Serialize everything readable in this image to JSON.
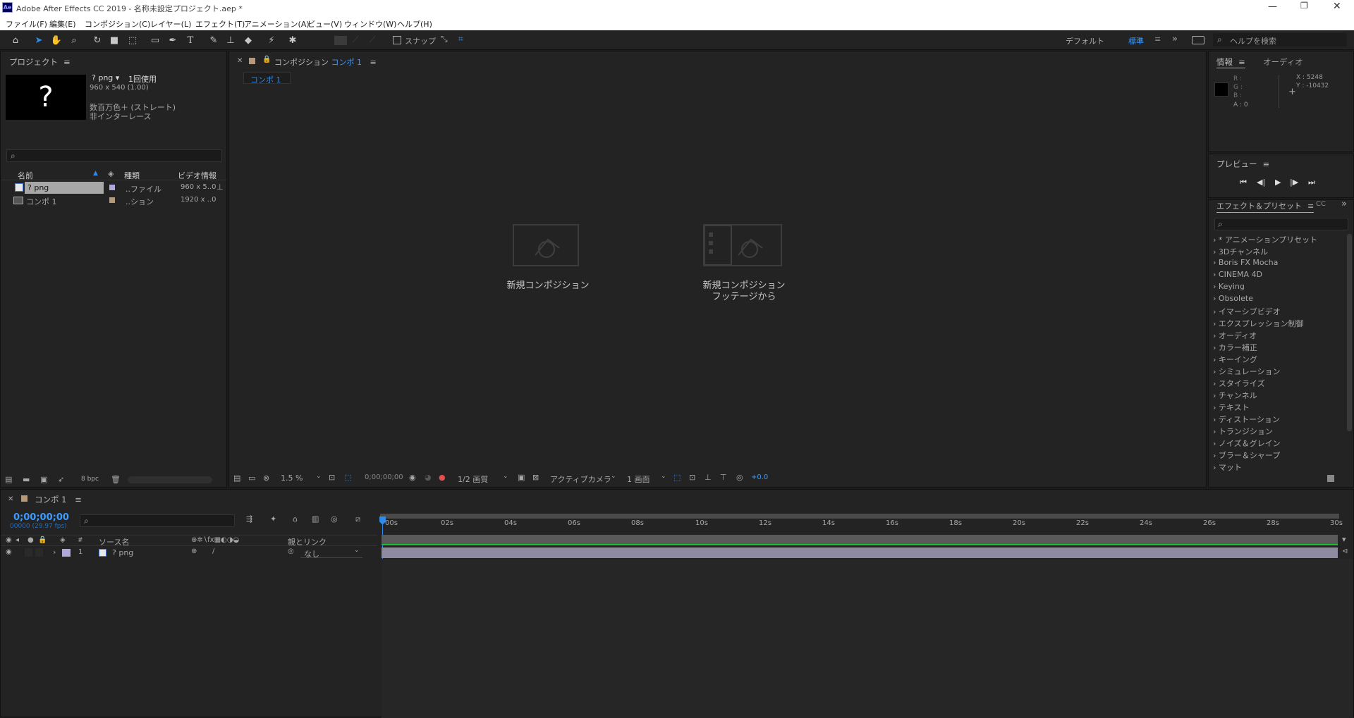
{
  "app": {
    "title": "Adobe After Effects CC 2019 - 名称未設定プロジェクト.aep *",
    "icon_text": "Ae",
    "accent": "#2d8ceb"
  },
  "menu": [
    "ファイル(F)",
    "編集(E)",
    "コンポジション(C)",
    "レイヤー(L)",
    "エフェクト(T)",
    "アニメーション(A)",
    "ビュー(V)",
    "ウィンドウ(W)",
    "ヘルプ(H)"
  ],
  "toolbar": {
    "snap_label": "スナップ",
    "workspaces": [
      "デフォルト",
      "標準"
    ],
    "search_placeholder": "ヘルプを検索"
  },
  "project": {
    "title": "プロジェクト",
    "thumb_glyph": "?",
    "item_name": "? png ▾",
    "usage": "1回使用",
    "dims": "960 x 540 (1.00)",
    "color": "数百万色＋ (ストレート)",
    "interlace": "非インターレース",
    "columns": [
      "名前",
      "種類",
      "ビデオ情報"
    ],
    "rows": [
      {
        "name": "? png",
        "type": "..ファイル",
        "video": "960 x 5..0",
        "label_color": "#b0a8d8"
      },
      {
        "name": "コンポ 1",
        "type": "..ション",
        "video": "1920 x ..0",
        "label_color": "#b49a7a"
      }
    ],
    "bpc": "8 bpc"
  },
  "composition": {
    "panel_label": "コンポジション",
    "comp_name": "コンポ 1",
    "tab": "コンポ 1",
    "new_comp": "新規コンポジション",
    "new_comp_footage_1": "新規コンポジション",
    "new_comp_footage_2": "フッテージから",
    "zoom": "1.5 %",
    "timecode": "0;00;00;00",
    "resolution": "1/2 画質",
    "camera": "アクティブカメラ",
    "views": "1 画面",
    "exposure": "+0.0"
  },
  "info": {
    "title": "情報",
    "audio_tab": "オーディオ",
    "r": "R :",
    "g": "G :",
    "b": "B :",
    "a": "A : 0",
    "x": "X : 5248",
    "y": "Y : -10432"
  },
  "preview": {
    "title": "プレビュー"
  },
  "effects": {
    "title": "エフェクト＆プリセット",
    "cc_tab": "CC",
    "items": [
      "* アニメーションプリセット",
      "3Dチャンネル",
      "Boris FX Mocha",
      "CINEMA 4D",
      "Keying",
      "Obsolete",
      "イマーシブビデオ",
      "エクスプレッション制御",
      "オーディオ",
      "カラー補正",
      "キーイング",
      "シミュレーション",
      "スタイライズ",
      "チャンネル",
      "テキスト",
      "ディストーション",
      "トランジション",
      "ノイズ＆グレイン",
      "ブラー＆シャープ",
      "マット"
    ]
  },
  "timeline": {
    "tab": "コンポ 1",
    "timecode": "0;00;00;00",
    "fps": "00000 (29.97 fps)",
    "col_num": "#",
    "col_source": "ソース名",
    "col_parent": "親とリンク",
    "layer": {
      "num": "1",
      "name": "? png",
      "parent": "なし",
      "label_color": "#b0a8d8"
    },
    "ticks": [
      "00s",
      "02s",
      "04s",
      "06s",
      "08s",
      "10s",
      "12s",
      "14s",
      "16s",
      "18s",
      "20s",
      "22s",
      "24s",
      "26s",
      "28s",
      "30s"
    ]
  }
}
